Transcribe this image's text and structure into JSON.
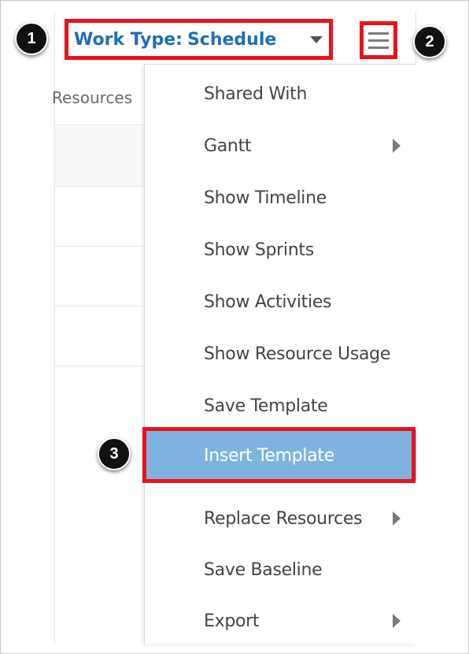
{
  "header": {
    "work_type_label": "Work Type:",
    "work_type_value": "Schedule"
  },
  "grid": {
    "column_header": "Resources"
  },
  "menu": {
    "items": [
      {
        "label": "Shared With",
        "has_submenu": false
      },
      {
        "label": "Gantt",
        "has_submenu": true
      },
      {
        "label": "Show Timeline",
        "has_submenu": false
      },
      {
        "label": "Show Sprints",
        "has_submenu": false
      },
      {
        "label": "Show Activities",
        "has_submenu": false
      },
      {
        "label": "Show Resource Usage",
        "has_submenu": false
      },
      {
        "label": "Save Template",
        "has_submenu": false
      },
      {
        "label": "Insert Template",
        "has_submenu": false,
        "highlighted": true
      },
      {
        "label": "Replace Resources",
        "has_submenu": true
      },
      {
        "label": "Save Baseline",
        "has_submenu": false
      },
      {
        "label": "Export",
        "has_submenu": true
      }
    ]
  },
  "annotations": {
    "badge_1": "1",
    "badge_2": "2",
    "badge_3": "3",
    "highlight_color": "#e8121b"
  },
  "colors": {
    "accent": "#1f6fb2",
    "menu_highlight": "#7fb3df"
  },
  "icons": {
    "hamburger": "menu-icon",
    "dropdown": "caret-down-icon",
    "submenu": "caret-right-icon"
  }
}
